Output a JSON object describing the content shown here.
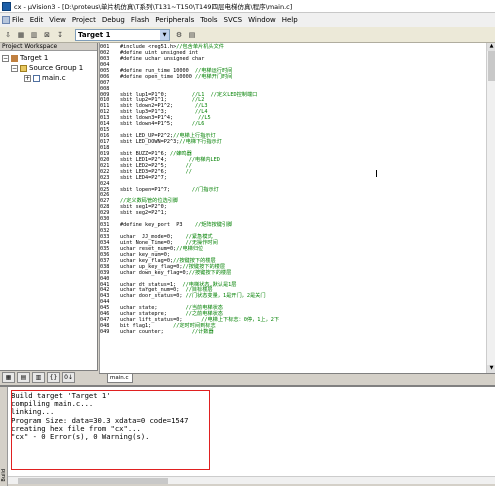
{
  "window": {
    "title": "cx - µVision3 - [D:\\proteus\\单片机仿真\\T系列\\T131~T150\\T149四层电梯仿真\\程序\\main.c]"
  },
  "menu": [
    "File",
    "Edit",
    "View",
    "Project",
    "Debug",
    "Flash",
    "Peripherals",
    "Tools",
    "SVCS",
    "Window",
    "Help"
  ],
  "toolbar": {
    "target": "Target 1"
  },
  "workspace": {
    "header": "Project Workspace",
    "tree": {
      "target": "Target 1",
      "group": "Source Group 1",
      "file": "main.c"
    }
  },
  "editor": {
    "tab": "main.c",
    "lines": [
      {
        "n": "001",
        "code": "#include <reg51.h>",
        "cmt": "//包含单片机头文件"
      },
      {
        "n": "002",
        "code": "#define uint unsigned int",
        "cmt": ""
      },
      {
        "n": "003",
        "code": "#define uchar unsigned char",
        "cmt": ""
      },
      {
        "n": "004",
        "code": "",
        "cmt": ""
      },
      {
        "n": "005",
        "code": "#define run_time 10000  ",
        "cmt": "//电梯运行时间"
      },
      {
        "n": "006",
        "code": "#define open_time 10000 ",
        "cmt": "//电梯开门时间"
      },
      {
        "n": "007",
        "code": "",
        "cmt": ""
      },
      {
        "n": "008",
        "code": "",
        "cmt": ""
      },
      {
        "n": "009",
        "code": "sbit lup1=P1^0;        ",
        "cmt": "//L1  //定义LED控制端口"
      },
      {
        "n": "010",
        "code": "sbit lup2=P1^1;        ",
        "cmt": "//L2"
      },
      {
        "n": "011",
        "code": "sbit ldown2=P1^2;       ",
        "cmt": "//L3"
      },
      {
        "n": "012",
        "code": "sbit lup3=P1^3;         ",
        "cmt": "//L4"
      },
      {
        "n": "013",
        "code": "sbit ldown3=P1^4;        ",
        "cmt": "//L5"
      },
      {
        "n": "014",
        "code": "sbit ldown4=P1^5;      ",
        "cmt": "//L6"
      },
      {
        "n": "015",
        "code": "",
        "cmt": ""
      },
      {
        "n": "016",
        "code": "sbit LED_UP=P2^2;",
        "cmt": "//电梯上行指示灯"
      },
      {
        "n": "017",
        "code": "sbit LED_DOWN=P2^3;",
        "cmt": "//电梯下行指示灯"
      },
      {
        "n": "018",
        "code": "",
        "cmt": ""
      },
      {
        "n": "019",
        "code": "sbit BUZZ=P1^6; ",
        "cmt": "//蜂鸣器"
      },
      {
        "n": "020",
        "code": "sbit LED1=P2^4;       ",
        "cmt": "//电梯内LED"
      },
      {
        "n": "021",
        "code": "sbit LED2=P2^5;      ",
        "cmt": "//"
      },
      {
        "n": "022",
        "code": "sbit LED3=P2^6;      ",
        "cmt": "//"
      },
      {
        "n": "023",
        "code": "sbit LED4=P2^7;",
        "cmt": ""
      },
      {
        "n": "024",
        "code": "",
        "cmt": ""
      },
      {
        "n": "025",
        "code": "sbit lopen=P1^7;       ",
        "cmt": "//门指示灯"
      },
      {
        "n": "026",
        "code": "",
        "cmt": ""
      },
      {
        "n": "027",
        "code": "",
        "cmt": "//定义数码管的位选引脚"
      },
      {
        "n": "028",
        "code": "sbit seg1=P2^0;",
        "cmt": ""
      },
      {
        "n": "029",
        "code": "sbit seg2=P2^1;",
        "cmt": ""
      },
      {
        "n": "030",
        "code": "",
        "cmt": ""
      },
      {
        "n": "031",
        "code": "#define key_port  P3    ",
        "cmt": "//矩阵按键引脚"
      },
      {
        "n": "032",
        "code": "",
        "cmt": ""
      },
      {
        "n": "033",
        "code": "uchar  JJ_mode=0;    ",
        "cmt": "//紧急模式"
      },
      {
        "n": "034",
        "code": "uint None_Time=0;    ",
        "cmt": "//无操作时间"
      },
      {
        "n": "035",
        "code": "uchar reset_num=0;",
        "cmt": "//电梯归位"
      },
      {
        "n": "036",
        "code": "uchar key_num=0;",
        "cmt": ""
      },
      {
        "n": "037",
        "code": "uchar key_flag=0;",
        "cmt": "//按键按下的楼层"
      },
      {
        "n": "038",
        "code": "uchar up_key_flag=0;",
        "cmt": "//按键按下的楼层"
      },
      {
        "n": "039",
        "code": "uchar down_key_flag=0;",
        "cmt": "//按键按下的楼层"
      },
      {
        "n": "040",
        "code": "",
        "cmt": ""
      },
      {
        "n": "041",
        "code": "uchar dt_status=1;  ",
        "cmt": "//电梯状态,默认是1层"
      },
      {
        "n": "042",
        "code": "uchar target_num=0;  ",
        "cmt": "//目标楼层"
      },
      {
        "n": "043",
        "code": "uchar door_status=0; ",
        "cmt": "//门状态变量，1是开门，2是关门"
      },
      {
        "n": "044",
        "code": "",
        "cmt": ""
      },
      {
        "n": "045",
        "code": "uchar state;         ",
        "cmt": "//当前电梯状态"
      },
      {
        "n": "046",
        "code": "uchar statepre;      ",
        "cmt": "//之前电梯状态"
      },
      {
        "n": "047",
        "code": "uchar lift_status=0;      ",
        "cmt": "//电梯上下标志：0停，1上，2下"
      },
      {
        "n": "048",
        "code": "bit flag1;       ",
        "cmt": "//定时时间到标志"
      },
      {
        "n": "049",
        "code": "uchar counter;         ",
        "cmt": "//计数器"
      }
    ]
  },
  "output": {
    "lines": [
      "Build target 'Target 1'",
      "compiling main.c...",
      "linking...",
      "Program Size: data=30.3 xdata=0 code=1547",
      "creating hex file from \"cx\"...",
      "\"cx\" - 0 Error(s), 0 Warning(s)."
    ],
    "side_label": "Build"
  },
  "colors": {
    "highlight_box": "#e02020",
    "comment": "#008000"
  }
}
